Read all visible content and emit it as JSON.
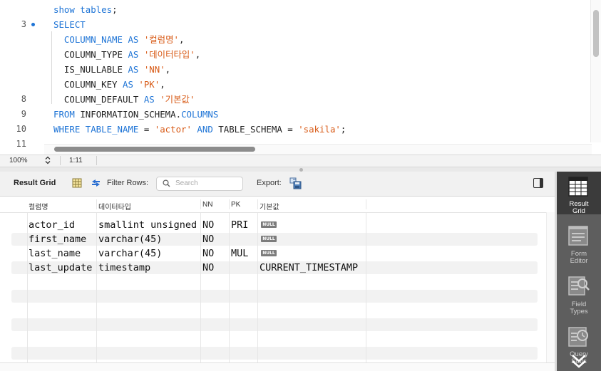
{
  "editor": {
    "lines": [
      {
        "num": "",
        "tokens": [
          {
            "t": "show tables",
            "c": "kw"
          },
          {
            "t": ";",
            "c": "plain"
          }
        ]
      },
      {
        "num": "3",
        "marker": true,
        "tokens": [
          {
            "t": "SELECT",
            "c": "kw"
          }
        ]
      },
      {
        "num": "",
        "tokens": [
          {
            "t": "  COLUMN_NAME ",
            "c": "kw"
          },
          {
            "t": "AS ",
            "c": "kw"
          },
          {
            "t": "'컬럼명'",
            "c": "str"
          },
          {
            "t": ",",
            "c": "plain"
          }
        ]
      },
      {
        "num": "",
        "tokens": [
          {
            "t": "  COLUMN_TYPE ",
            "c": "plain"
          },
          {
            "t": "AS ",
            "c": "kw"
          },
          {
            "t": "'데이터타입'",
            "c": "str"
          },
          {
            "t": ",",
            "c": "plain"
          }
        ]
      },
      {
        "num": "",
        "tokens": [
          {
            "t": "  IS_NULLABLE ",
            "c": "plain"
          },
          {
            "t": "AS ",
            "c": "kw"
          },
          {
            "t": "'NN'",
            "c": "str"
          },
          {
            "t": ",",
            "c": "plain"
          }
        ]
      },
      {
        "num": "",
        "tokens": [
          {
            "t": "  COLUMN_KEY ",
            "c": "plain"
          },
          {
            "t": "AS ",
            "c": "kw"
          },
          {
            "t": "'PK'",
            "c": "str"
          },
          {
            "t": ",",
            "c": "plain"
          }
        ]
      },
      {
        "num": "8",
        "tokens": [
          {
            "t": "  COLUMN_DEFAULT ",
            "c": "plain"
          },
          {
            "t": "AS ",
            "c": "kw"
          },
          {
            "t": "'기본값'",
            "c": "str"
          }
        ]
      },
      {
        "num": "9",
        "tokens": [
          {
            "t": "FROM ",
            "c": "kw"
          },
          {
            "t": "INFORMATION_SCHEMA",
            "c": "plain"
          },
          {
            "t": ".",
            "c": "plain"
          },
          {
            "t": "COLUMNS",
            "c": "kw"
          }
        ]
      },
      {
        "num": "10",
        "tokens": [
          {
            "t": "WHERE ",
            "c": "kw"
          },
          {
            "t": "TABLE_NAME ",
            "c": "kw"
          },
          {
            "t": "= ",
            "c": "plain"
          },
          {
            "t": "'actor'",
            "c": "str"
          },
          {
            "t": " AND ",
            "c": "kw"
          },
          {
            "t": "TABLE_SCHEMA ",
            "c": "plain"
          },
          {
            "t": "= ",
            "c": "plain"
          },
          {
            "t": "'sakila'",
            "c": "str"
          },
          {
            "t": ";",
            "c": "plain"
          }
        ]
      },
      {
        "num": "11",
        "tokens": []
      }
    ]
  },
  "statusbar": {
    "zoom": "100%",
    "cursor": "1:11"
  },
  "result_toolbar": {
    "title": "Result Grid",
    "filter_label": "Filter Rows:",
    "search_placeholder": "Search",
    "export_label": "Export:"
  },
  "grid": {
    "columns": [
      "컬럼명",
      "데이터타입",
      "NN",
      "PK",
      "기본값"
    ],
    "null_badge": "NULL",
    "rows": [
      [
        "actor_id",
        "smallint unsigned",
        "NO",
        "PRI",
        null
      ],
      [
        "first_name",
        "varchar(45)",
        "NO",
        "",
        null
      ],
      [
        "last_name",
        "varchar(45)",
        "NO",
        "MUL",
        null
      ],
      [
        "last_update",
        "timestamp",
        "NO",
        "",
        "CURRENT_TIMESTAMP"
      ]
    ]
  },
  "sidebar": {
    "items": [
      {
        "label1": "Result",
        "label2": "Grid",
        "icon": "grid-icon",
        "active": true
      },
      {
        "label1": "Form",
        "label2": "Editor",
        "icon": "form-icon",
        "active": false
      },
      {
        "label1": "Field",
        "label2": "Types",
        "icon": "field-types-icon",
        "active": false
      },
      {
        "label1": "Query",
        "label2": "Stats",
        "icon": "query-stats-icon",
        "active": false
      }
    ]
  },
  "colors": {
    "keyword": "#1e74d6",
    "string": "#d85a16",
    "sidebar_bg": "#5e5e5e",
    "sidebar_active": "#3b3b3b"
  }
}
